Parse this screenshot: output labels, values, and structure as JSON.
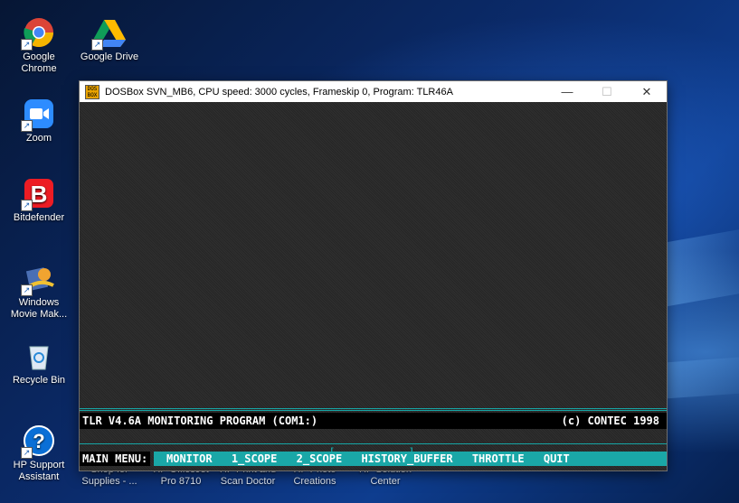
{
  "desktop": {
    "icons": [
      {
        "name": "google-chrome-shortcut",
        "icon": "chrome-icon",
        "label": "Google Chrome"
      },
      {
        "name": "google-drive-shortcut",
        "icon": "google-drive-icon",
        "label": "Google Drive"
      },
      {
        "name": "zoom-shortcut",
        "icon": "zoom-icon",
        "label": "Zoom"
      },
      {
        "name": "bitdefender-shortcut",
        "icon": "bitdefender-icon",
        "label": "Bitdefender"
      },
      {
        "name": "windows-movie-maker-shortcut",
        "icon": "movie-maker-icon",
        "label": "Windows Movie Mak..."
      },
      {
        "name": "recycle-bin",
        "icon": "recycle-bin-icon",
        "label": "Recycle Bin"
      },
      {
        "name": "hp-support-assistant-shortcut",
        "icon": "hp-support-icon",
        "label": "HP Support Assistant"
      }
    ],
    "partial_labels": [
      "Supplies - ...",
      "Pro 8710",
      "Scan Doctor",
      "Creations",
      "Center",
      "Shop for",
      "HP OfficeJet",
      "HP Print and",
      "HP Photo",
      "HP Solution"
    ]
  },
  "window": {
    "title": "DOSBox SVN_MB6, CPU speed:     3000 cycles, Frameskip  0, Program:   TLR46A",
    "minimize": "—",
    "maximize": "☐",
    "close": "✕",
    "app_icon_text": "DOS BOX"
  },
  "program": {
    "status_left": "TLR V4.6A MONITORING PROGRAM (COM1:)",
    "status_right": "(c) CONTEC 1998",
    "menu_label": "MAIN MENU:",
    "menu_items": [
      "MONITOR",
      "1_SCOPE",
      "2_SCOPE",
      "HISTORY_BUFFER",
      "THROTTLE",
      "QUIT"
    ],
    "bracket_left": "[",
    "bracket_right": "]"
  },
  "colors": {
    "menu_bar": "#1aa7a7",
    "dos_background": "#2b2b2b",
    "status_background": "#000000"
  }
}
